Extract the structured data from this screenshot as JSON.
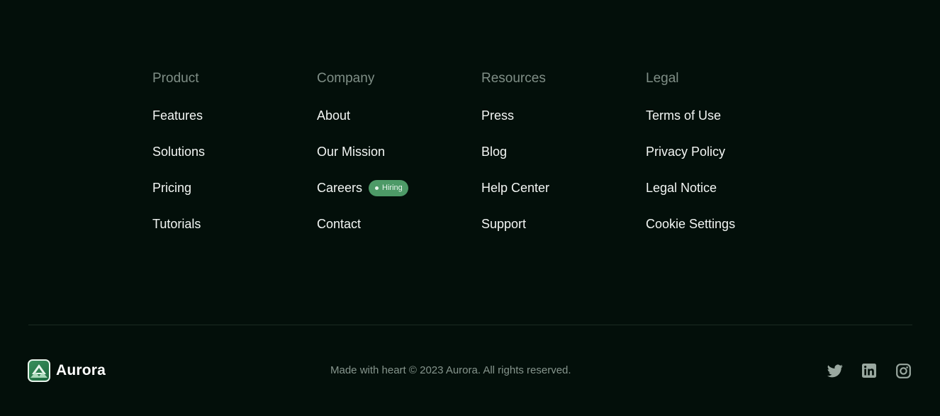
{
  "columns": [
    {
      "heading": "Product",
      "links": [
        {
          "label": "Features"
        },
        {
          "label": "Solutions"
        },
        {
          "label": "Pricing"
        },
        {
          "label": "Tutorials"
        }
      ]
    },
    {
      "heading": "Company",
      "links": [
        {
          "label": "About"
        },
        {
          "label": "Our Mission"
        },
        {
          "label": "Careers",
          "badge": "Hiring"
        },
        {
          "label": "Contact"
        }
      ]
    },
    {
      "heading": "Resources",
      "links": [
        {
          "label": "Press"
        },
        {
          "label": "Blog"
        },
        {
          "label": "Help Center"
        },
        {
          "label": "Support"
        }
      ]
    },
    {
      "heading": "Legal",
      "links": [
        {
          "label": "Terms of Use"
        },
        {
          "label": "Privacy Policy"
        },
        {
          "label": "Legal Notice"
        },
        {
          "label": "Cookie Settings"
        }
      ]
    }
  ],
  "brand": {
    "name": "Aurora",
    "logo_icon": "mountain-logo-icon"
  },
  "copyright": "Made with heart © 2023 Aurora. All rights reserved.",
  "socials": [
    {
      "icon": "twitter-icon"
    },
    {
      "icon": "linkedin-icon"
    },
    {
      "icon": "instagram-icon"
    }
  ],
  "colors": {
    "background": "#030f0a",
    "heading": "#7f8e86",
    "link": "#f3f6f4",
    "badge": "#4d9a67",
    "muted": "#86958d"
  }
}
